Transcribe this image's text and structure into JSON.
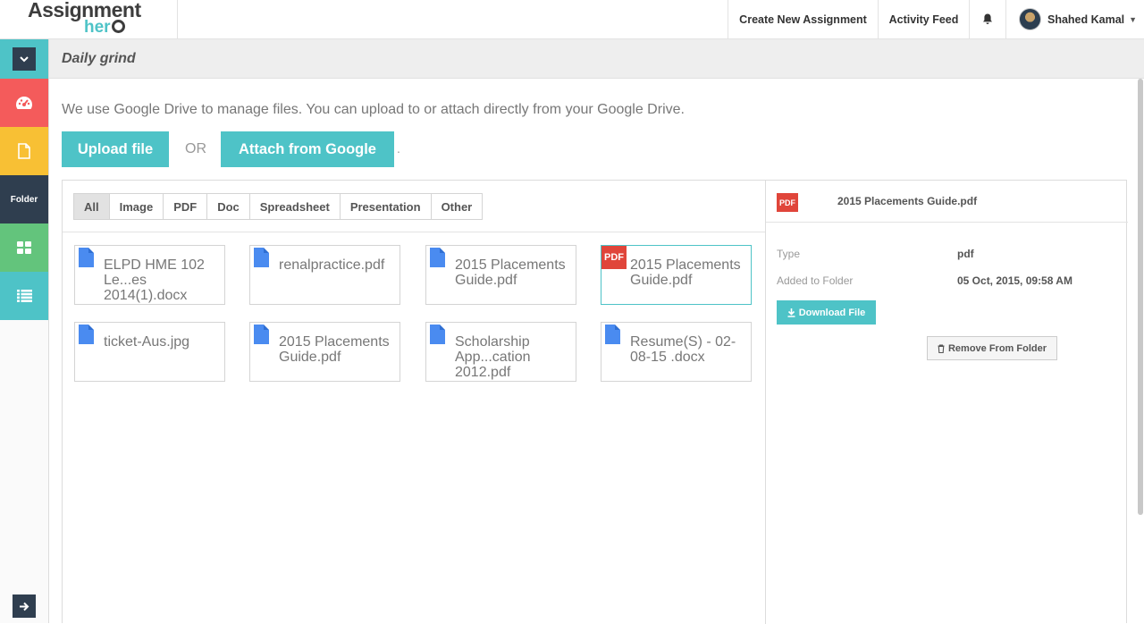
{
  "header": {
    "logo_top": "Assignment",
    "logo_bottom": "her",
    "nav": {
      "create": "Create New Assignment",
      "activity": "Activity Feed",
      "user": "Shahed Kamal"
    }
  },
  "sidebar": {
    "folder_label": "Folder"
  },
  "page": {
    "title": "Daily grind",
    "intro": "We use Google Drive to manage files. You can upload to or attach directly from your Google Drive.",
    "upload_label": "Upload file",
    "or_label": "OR",
    "attach_label": "Attach from Google",
    "trailing_dot": "."
  },
  "filters": [
    "All",
    "Image",
    "PDF",
    "Doc",
    "Spreadsheet",
    "Presentation",
    "Other"
  ],
  "files": [
    {
      "name": "ELPD HME 102 Le...es 2014(1).docx",
      "icon": "doc-icon"
    },
    {
      "name": "renalpractice.pdf",
      "icon": "doc-icon"
    },
    {
      "name": "2015 Placements Guide.pdf",
      "icon": "doc-icon"
    },
    {
      "name": "2015 Placements Guide.pdf",
      "icon": "pdf-icon",
      "pdf_text": "PDF"
    },
    {
      "name": "ticket-Aus.jpg",
      "icon": "doc-icon"
    },
    {
      "name": "2015 Placements Guide.pdf",
      "icon": "doc-icon"
    },
    {
      "name": "Scholarship App...cation 2012.pdf",
      "icon": "doc-icon"
    },
    {
      "name": "Resume(S) - 02-08-15 .docx",
      "icon": "doc-icon"
    }
  ],
  "detail": {
    "icon_text": "PDF",
    "title": "2015 Placements Guide.pdf",
    "type_label": "Type",
    "type_value": "pdf",
    "added_label": "Added to Folder",
    "added_value": "05 Oct, 2015, 09:58 AM",
    "download_label": "Download File",
    "remove_label": "Remove From Folder"
  },
  "colors": {
    "accent": "#4ec3c7",
    "dark": "#2f3e4f",
    "red": "#f45b5b",
    "yellow": "#f8c034",
    "green": "#63c47c",
    "pdf_red": "#e0453a",
    "doc_blue": "#4a8bf0"
  }
}
